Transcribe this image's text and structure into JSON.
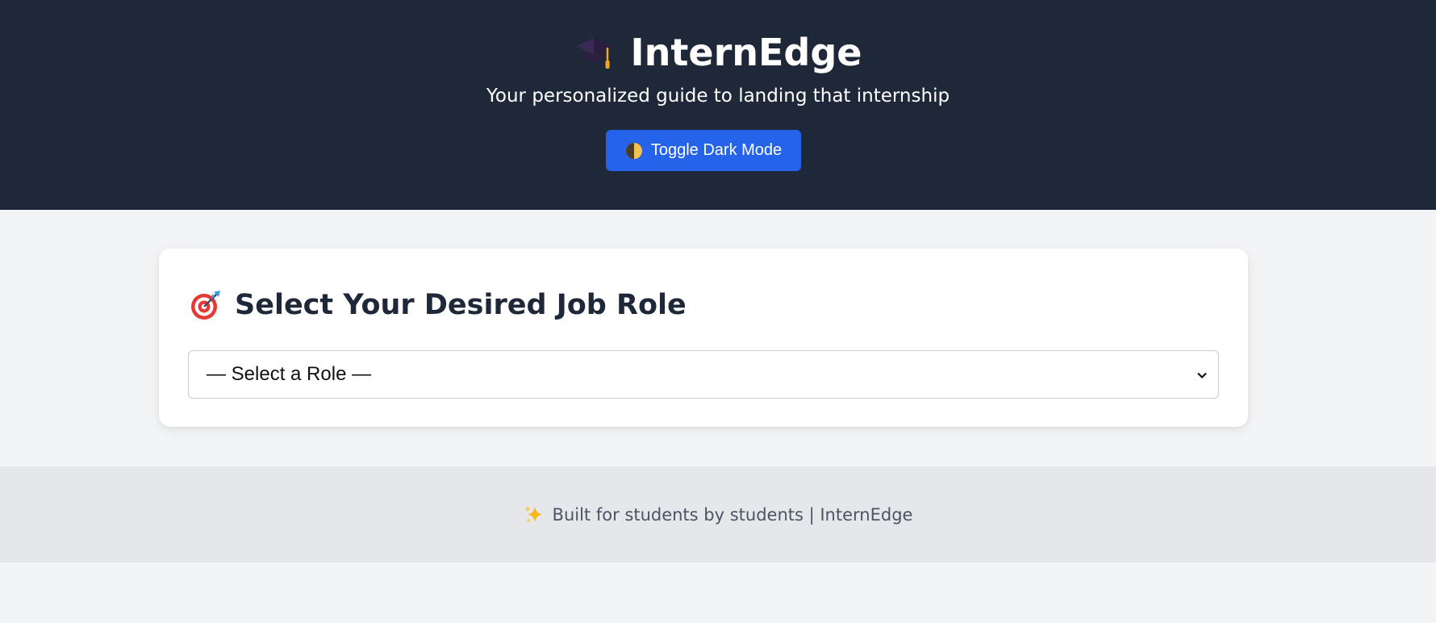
{
  "header": {
    "brand_icon": "graduation-cap-icon",
    "title": "InternEdge",
    "tagline": "Your personalized guide to landing that internship",
    "toggle_button": {
      "icon": "half-circle-icon",
      "label": "Toggle Dark Mode"
    }
  },
  "card": {
    "heading_icon": "target-icon",
    "title": "Select Your Desired Job Role",
    "role_select": {
      "selected": "— Select a Role —"
    }
  },
  "footer": {
    "icon": "sparkle-icon",
    "text": "Built for students by students | InternEdge"
  },
  "colors": {
    "header_bg": "#1f2838",
    "page_bg": "#f3f4f6",
    "footer_bg": "#e5e7eb",
    "accent": "#2563eb",
    "heading_text": "#1f2838",
    "footer_text": "#4b5563"
  }
}
